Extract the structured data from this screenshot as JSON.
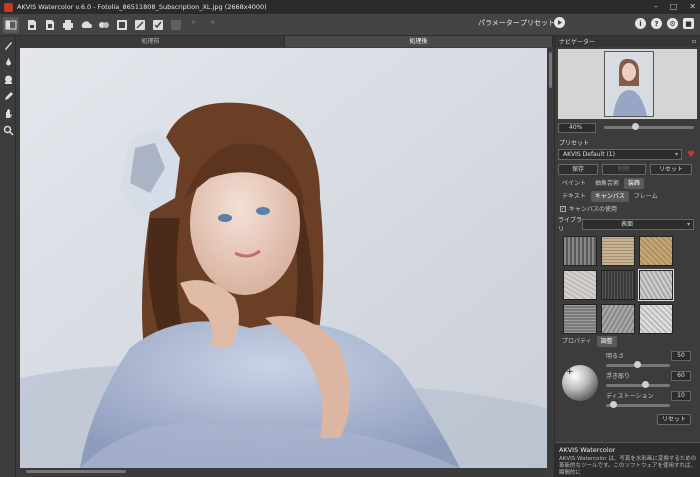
{
  "window": {
    "title": "AKVIS Watercolor v.6.0 - Fotolia_86511808_Subscription_XL.jpg (2668x4000)"
  },
  "toolbar": {
    "params_label": "パラメーター",
    "presets_label": "プリセット"
  },
  "tabs": {
    "before": "処理前",
    "after": "処理後"
  },
  "navigator": {
    "title": "ナビゲーター",
    "zoom": "40%"
  },
  "preset": {
    "label": "プリセット",
    "selected": "AKVIS Default (1)",
    "save": "保存",
    "delete": "削除",
    "reset": "リセット"
  },
  "main_tabs": [
    "ペイント",
    "抽象芸術",
    "装飾"
  ],
  "sub_tabs": [
    "テキスト",
    "キャンバス",
    "フレーム"
  ],
  "canvas_settings": {
    "use_canvas": "キャンバスの使用",
    "library_label": "ライブラリ",
    "library_value": "表面"
  },
  "adjust_tabs": [
    "プロパティ",
    "調整"
  ],
  "adjust": {
    "brightness": {
      "label": "明るさ",
      "value": "50"
    },
    "relief": {
      "label": "浮き彫り",
      "value": "60"
    },
    "distortion": {
      "label": "ディストーション",
      "value": "10"
    },
    "reset": "リセット"
  },
  "info": {
    "title": "AKVIS Watercolor",
    "text": "AKVIS Watercolor は、写真を水彩画に変換するための革新的なツールです。このソフトウェアを使用すれば、瞬間的に"
  },
  "colors": {
    "bg": "#3c3c3c",
    "accent": "#c23b2b",
    "favorite": "#c0392b"
  }
}
